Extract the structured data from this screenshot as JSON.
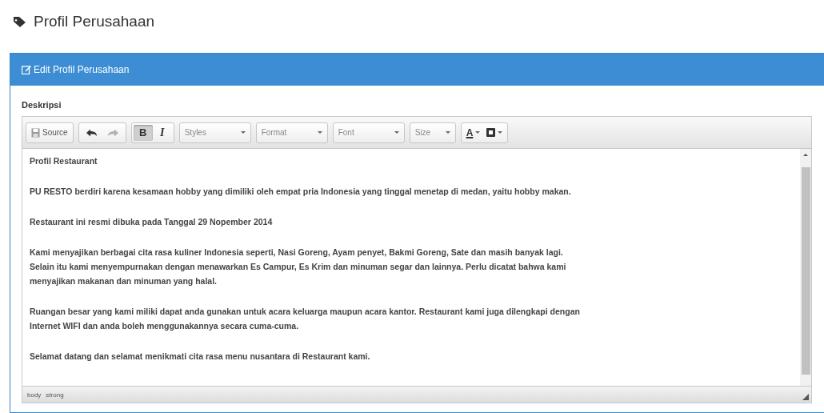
{
  "page_title": "Profil Perusahaan",
  "panel": {
    "title": "Edit Profil Perusahaan",
    "field_label": "Deskripsi",
    "toolbar": [
      {
        "kind": "source",
        "label": "Source"
      },
      {
        "kind": "undo",
        "disabled": false
      },
      {
        "kind": "redo",
        "disabled": true
      },
      {
        "kind": "bold",
        "label": "B",
        "selected": true
      },
      {
        "kind": "italic",
        "label": "I",
        "selected": false
      },
      {
        "kind": "combo",
        "label": "Styles"
      },
      {
        "kind": "combo",
        "label": "Format"
      },
      {
        "kind": "combo",
        "label": "Font"
      },
      {
        "kind": "combo",
        "label": "Size"
      },
      {
        "kind": "text-color",
        "label": "A"
      },
      {
        "kind": "bg-color"
      }
    ],
    "content": [
      {
        "lines": [
          "Profil Restaurant"
        ]
      },
      {
        "lines": [
          "PU RESTO berdiri karena kesamaan hobby yang dimiliki oleh empat pria Indonesia yang tinggal menetap di medan, yaitu hobby makan."
        ]
      },
      {
        "lines": [
          "Restaurant ini resmi dibuka pada Tanggal 29 Nopember 2014"
        ]
      },
      {
        "lines": [
          "Kami menyajikan berbagai cita rasa kuliner Indonesia seperti, Nasi Goreng, Ayam penyet, Bakmi Goreng, Sate dan masih banyak lagi.",
          "Selain itu kami menyempurnakan dengan menawarkan Es Campur, Es Krim dan minuman segar dan lainnya. Perlu dicatat bahwa kami",
          "menyajikan makanan dan minuman yang halal."
        ]
      },
      {
        "lines": [
          "Ruangan besar yang kami miliki dapat anda gunakan untuk acara keluarga maupun acara kantor. Restaurant kami juga dilengkapi dengan",
          "Internet WIFI dan anda boleh menggunakannya secara cuma-cuma."
        ]
      },
      {
        "lines": [
          "Selamat datang dan selamat menikmati cita rasa menu nusantara di Restaurant kami."
        ]
      }
    ],
    "status_path": [
      "body",
      "strong"
    ]
  }
}
